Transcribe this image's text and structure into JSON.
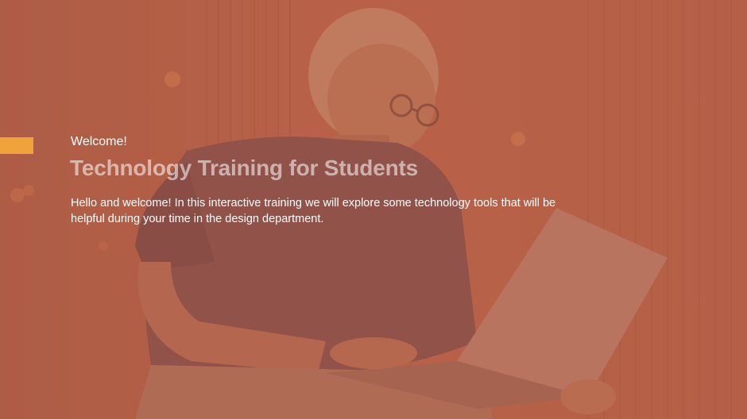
{
  "slide": {
    "welcome": "Welcome!",
    "title": "Technology Training for Students",
    "body": "Hello and welcome! In this interactive training we will explore some technology tools that will be helpful during your time in the design department."
  },
  "colors": {
    "overlay": "#b8644e",
    "accent": "#f0a33a",
    "text": "#ffffff"
  },
  "icons": {
    "accent_bar": "accent-bar"
  }
}
